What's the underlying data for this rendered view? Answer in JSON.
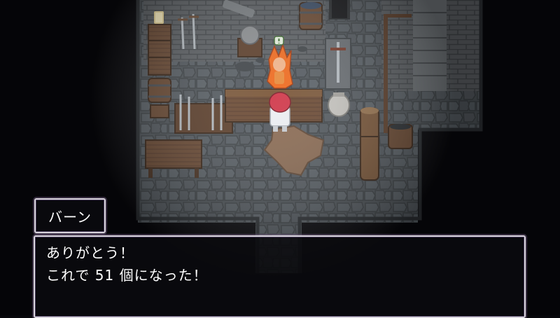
{
  "dialogue": {
    "speaker": "バーン",
    "lines": [
      "ありがとう！",
      "これで 51 個になった！"
    ]
  },
  "scene": {
    "location": "blacksmith-forge",
    "emote_icon": "exclamation-speech-bubble"
  }
}
